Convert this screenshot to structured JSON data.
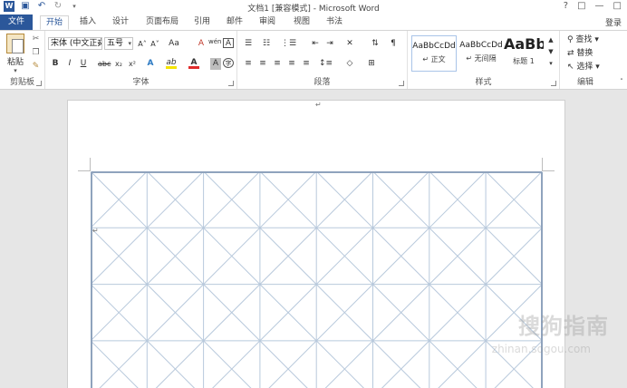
{
  "window": {
    "title": "文档1 [兼容模式] - Microsoft Word",
    "logo": "W",
    "controls": [
      "?",
      "□",
      "—",
      "□"
    ]
  },
  "tabs": [
    {
      "label": "文件"
    },
    {
      "label": "开始"
    },
    {
      "label": "插入"
    },
    {
      "label": "设计"
    },
    {
      "label": "页面布局"
    },
    {
      "label": "引用"
    },
    {
      "label": "邮件"
    },
    {
      "label": "审阅"
    },
    {
      "label": "视图"
    },
    {
      "label": "书法"
    }
  ],
  "login": "登录",
  "clipboard": {
    "paste": "粘贴",
    "label": "剪贴板"
  },
  "font": {
    "name": "宋体 (中文正文)",
    "size": "五号",
    "grow": "A˄",
    "shrink": "A˅",
    "case": "Aa",
    "clear": "A",
    "phonetic": "wén",
    "border_char": "A",
    "bold": "B",
    "italic": "I",
    "underline": "U",
    "strike": "abc",
    "sub": "x₂",
    "sup": "x²",
    "text_effect": "A",
    "highlight": "ab",
    "font_color": "A",
    "char_shade": "A",
    "enclose": "字",
    "label": "字体"
  },
  "paragraph": {
    "label": "段落"
  },
  "styles": {
    "items": [
      {
        "sample": "AaBbCcDd",
        "name": "↵ 正文"
      },
      {
        "sample": "AaBbCcDd",
        "name": "↵ 无间隔"
      },
      {
        "sample": "AaBb",
        "name": "标题 1"
      }
    ],
    "label": "样式"
  },
  "editing": {
    "find": "查找",
    "replace": "替换",
    "select": "选择",
    "label": "编辑"
  },
  "document": {
    "paragraph_mark": "↵"
  },
  "watermark": {
    "main": "搜狗指南",
    "sub": "zhinan.sogou.com"
  },
  "colors": {
    "accent": "#2b579a",
    "grid_line": "#b8c9dc",
    "grid_border": "#8fa3bd"
  }
}
